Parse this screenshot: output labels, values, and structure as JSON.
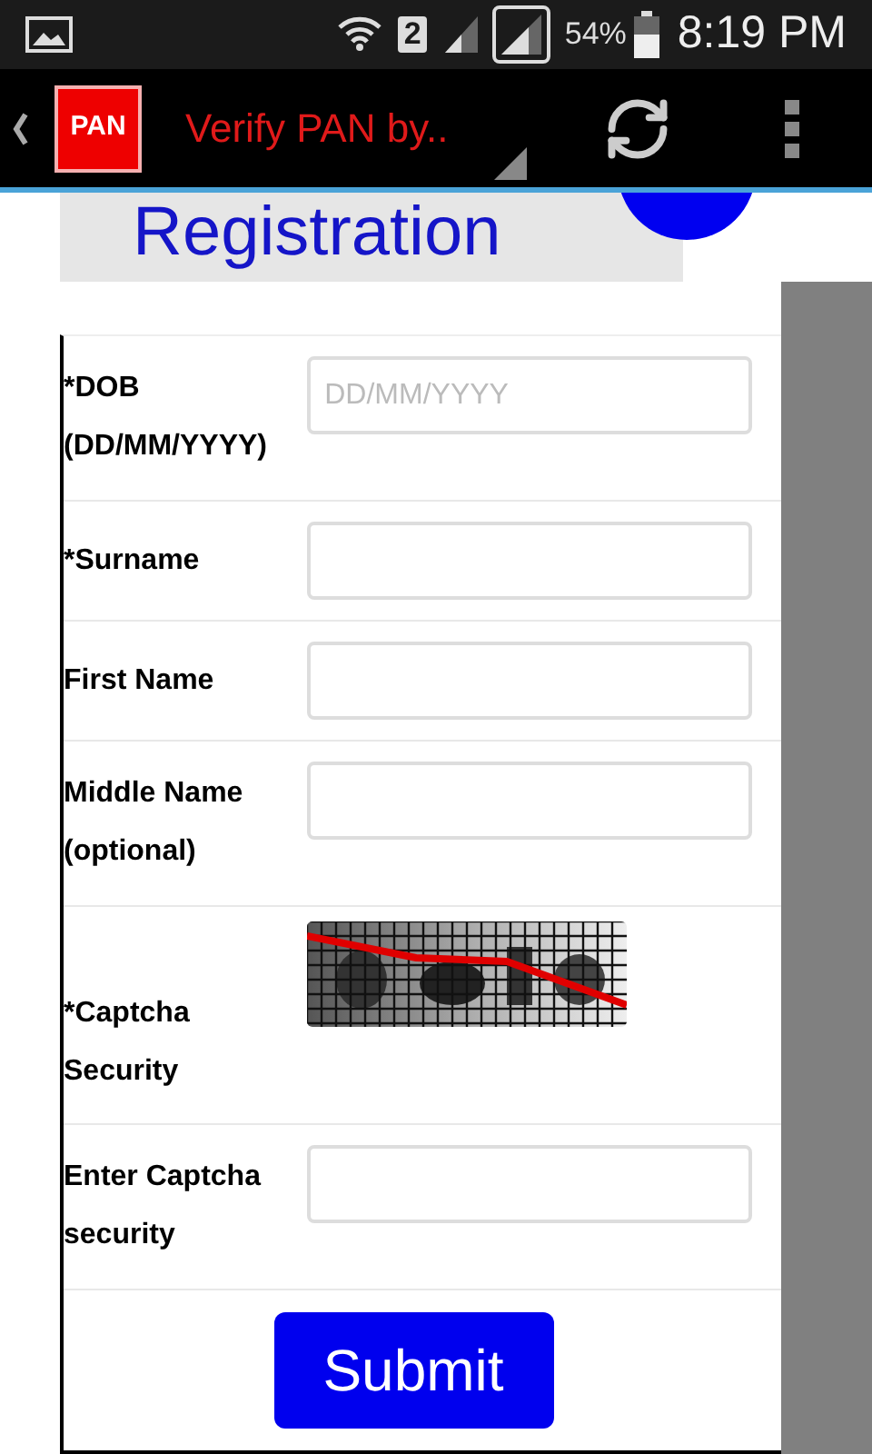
{
  "status_bar": {
    "sim": "2",
    "battery": "54%",
    "time": "8:19 PM"
  },
  "app_bar": {
    "logo": "PAN",
    "title": "Verify PAN by.."
  },
  "header": {
    "title": "Registration"
  },
  "form": {
    "rows": [
      {
        "kind": "input",
        "label": "*DOB (DD/MM/YYYY)",
        "placeholder": "DD/MM/YYYY"
      },
      {
        "kind": "input",
        "label": "*Surname"
      },
      {
        "kind": "input",
        "label": "First Name"
      },
      {
        "kind": "input",
        "label": "Middle Name (optional)"
      },
      {
        "kind": "captcha",
        "label": "*Captcha Security"
      },
      {
        "kind": "input",
        "label": "Enter Captcha security"
      }
    ],
    "submit": "Submit"
  }
}
